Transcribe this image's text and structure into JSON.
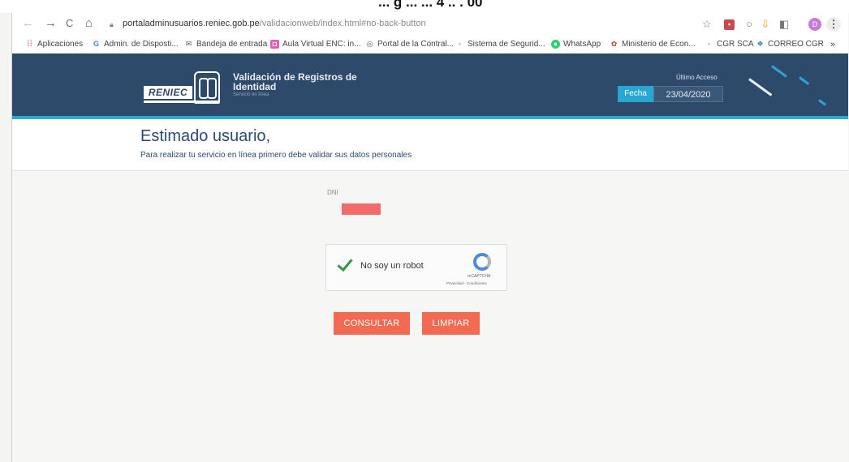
{
  "top_caption": "... g ... ... 4 .. . 00",
  "browser": {
    "nav": {
      "back": "←",
      "forward": "→",
      "reload": "C",
      "home": "⌂"
    },
    "url_host": "portaladminusuarios.reniec.gob.pe",
    "url_path": "/validacionweb/index.html#no-back-button",
    "avatar_letter": "D",
    "menu_glyph": "⋮",
    "star_glyph": "☆"
  },
  "bookmarks": [
    {
      "label": "Aplicaciones",
      "icon": "apps-icon",
      "color": "#d9534f"
    },
    {
      "label": "Admin. de Disposti...",
      "icon": "google-icon",
      "color": "#4285f4"
    },
    {
      "label": "Bandeja de entrada",
      "icon": "mail-icon",
      "color": "#555555"
    },
    {
      "label": "Aula Virtual ENC: in...",
      "icon": "aula-icon",
      "color": "#e05fb0"
    },
    {
      "label": "Portal de la Contral...",
      "icon": "portal-icon",
      "color": "#555555"
    },
    {
      "label": "Sistema de Segurid...",
      "icon": "shield-icon",
      "color": "#d9534f"
    },
    {
      "label": "WhatsApp",
      "icon": "whatsapp-icon",
      "color": "#25d366"
    },
    {
      "label": "Ministerio de Econ...",
      "icon": "ministry-icon",
      "color": "#b5473c"
    },
    {
      "label": "CGR SCA",
      "icon": "cgr-icon",
      "color": "#d9534f"
    },
    {
      "label": "CORREO CGR",
      "icon": "correo-icon",
      "color": "#2b78c2"
    }
  ],
  "bookmarks_more": "»",
  "header": {
    "logo_text": "RENIEC",
    "title": "Validación de Registros de Identidad",
    "subtitle": "Servicio en línea",
    "last_access_label": "Último Acceso",
    "date_label": "Fecha",
    "date_value": "23/04/2020",
    "colors": {
      "header_bg": "#2e4a6b",
      "accent": "#28a9d6"
    }
  },
  "main": {
    "greeting": "Estimado usuario,",
    "instruction": "Para realizar tu servicio en línea primero debe validar sus datos personales",
    "dni_label": "DNI",
    "dni_value_redacted": true,
    "recaptcha": {
      "label": "No soy un robot",
      "brand": "reCAPTCHA",
      "links": "Privacidad - Condiciones",
      "checked": true
    },
    "buttons": {
      "consultar": "CONSULTAR",
      "limpiar": "LIMPIAR"
    },
    "button_color": "#f26a52"
  }
}
